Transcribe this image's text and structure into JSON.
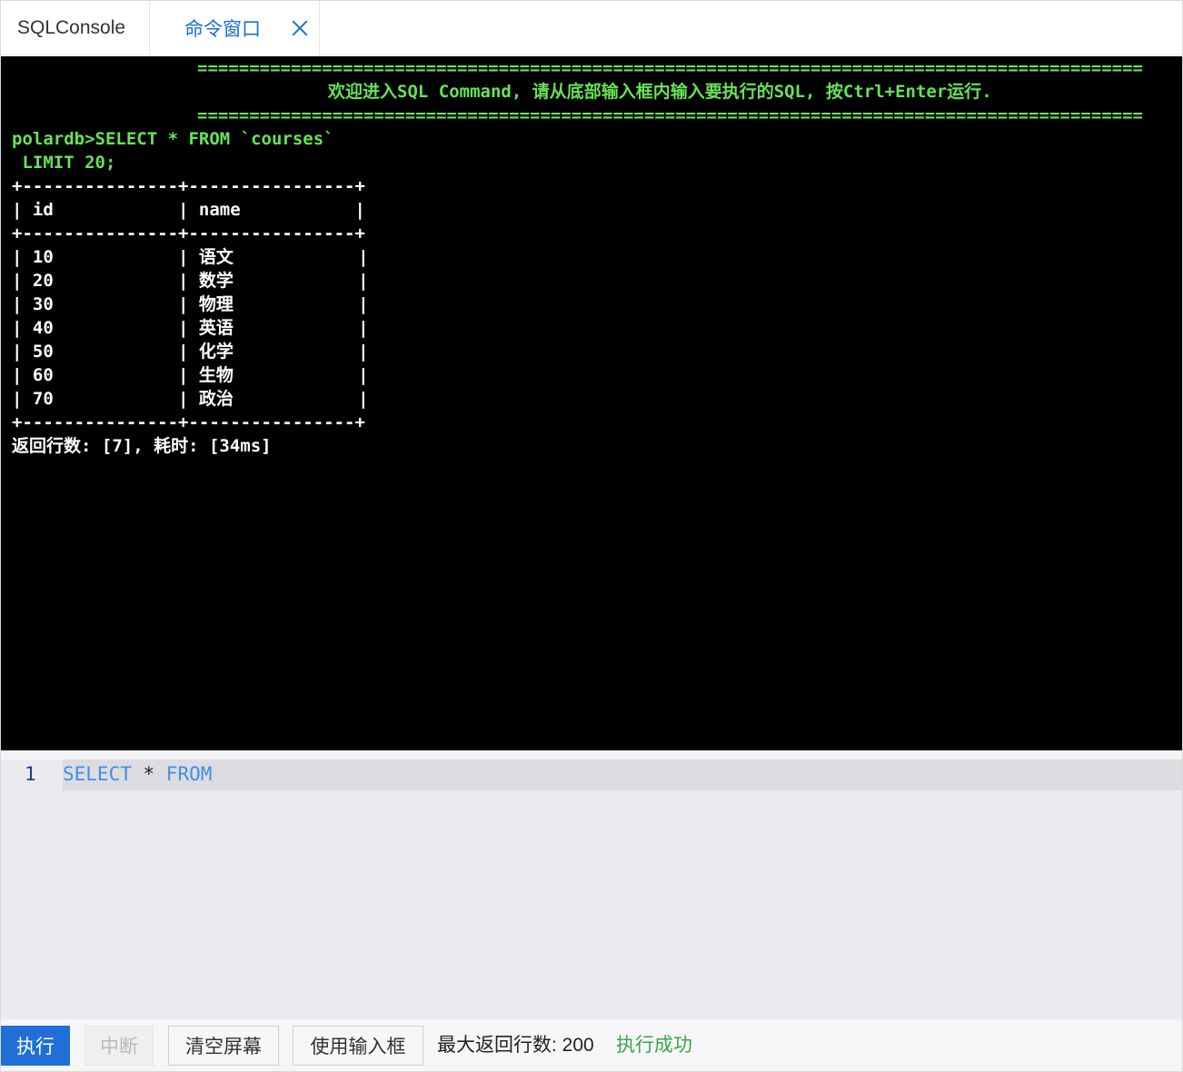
{
  "tabs": {
    "sqlconsole": "SQLConsole",
    "command_window": "命令窗口"
  },
  "terminal": {
    "separator": "===========================================================================================",
    "welcome": "欢迎进入SQL Command, 请从底部输入框内输入要执行的SQL, 按Ctrl+Enter运行.",
    "prompt_line1": "polardb>SELECT * FROM `courses`",
    "prompt_line2": " LIMIT 20;",
    "table_border": "+---------------+----------------+",
    "header_row": "| id            | name           |",
    "rows": [
      "| 10            | 语文            |",
      "| 20            | 数学            |",
      "| 30            | 物理            |",
      "| 40            | 英语            |",
      "| 50            | 化学            |",
      "| 60            | 生物            |",
      "| 70            | 政治            |"
    ],
    "result_summary": "返回行数: [7], 耗时: [34ms]"
  },
  "editor": {
    "line_number": "1",
    "kw_select": "SELECT",
    "op_star": " * ",
    "kw_from": "FROM"
  },
  "toolbar": {
    "run_label": "执行",
    "stop_label": "中断",
    "clear_label": "清空屏幕",
    "use_input_label": "使用输入框",
    "max_rows": "最大返回行数: 200",
    "status": "执行成功"
  },
  "colors": {
    "terminal_bg": "#000000",
    "terminal_green": "#67e257",
    "accent_blue": "#1f6fd6",
    "success_green": "#3aa54a",
    "sql_keyword": "#3f8fe6"
  }
}
